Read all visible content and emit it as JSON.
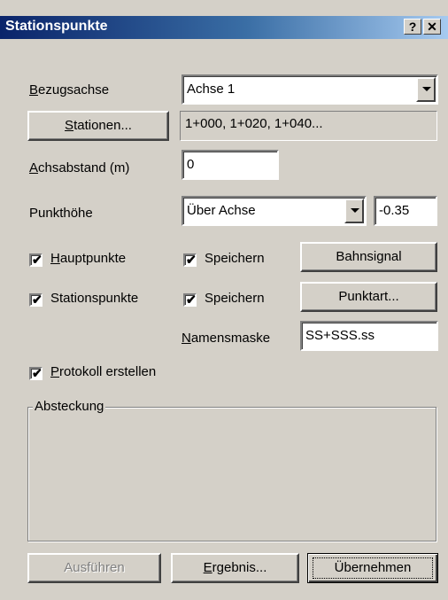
{
  "window": {
    "title": "Stationspunkte",
    "help_glyph": "?",
    "close_glyph": "✕"
  },
  "bezugsachse": {
    "label_u": "B",
    "label_rest": "ezugsachse",
    "value": "Achse 1"
  },
  "stationen": {
    "button_u": "S",
    "button_rest": "tationen...",
    "value": "1+000, 1+020, 1+040..."
  },
  "achsabstand": {
    "label_u": "A",
    "label_rest": "chsabstand (m)",
    "value": "0"
  },
  "punkthoehe": {
    "label": "Punkthöhe",
    "mode": "Über Achse",
    "value": "-0.35"
  },
  "hauptpunkte": {
    "checked": true,
    "label_u": "H",
    "label_rest": "auptpunkte",
    "save_label": "Speichern",
    "save_checked": true,
    "button": "Bahnsignal"
  },
  "stationspunkte": {
    "checked": true,
    "label": "Stationspunkte",
    "save_label": "Speichern",
    "save_checked": true,
    "button": "Punktart..."
  },
  "namensmaske": {
    "label_u": "N",
    "label_rest": "amensmaske",
    "value": "SS+SSS.ss"
  },
  "protokoll": {
    "checked": true,
    "label_u": "P",
    "label_rest": "rotokoll erstellen"
  },
  "absteckung": {
    "group_label": "Absteckung"
  },
  "footer": {
    "ausfuehren": "Ausführen",
    "ergebnis_u": "E",
    "ergebnis_rest": "rgebnis...",
    "uebernehmen": "Übernehmen"
  },
  "colors": {
    "face": "#d4d0c8",
    "title_start": "#0a246a",
    "title_end": "#a6caf0"
  }
}
